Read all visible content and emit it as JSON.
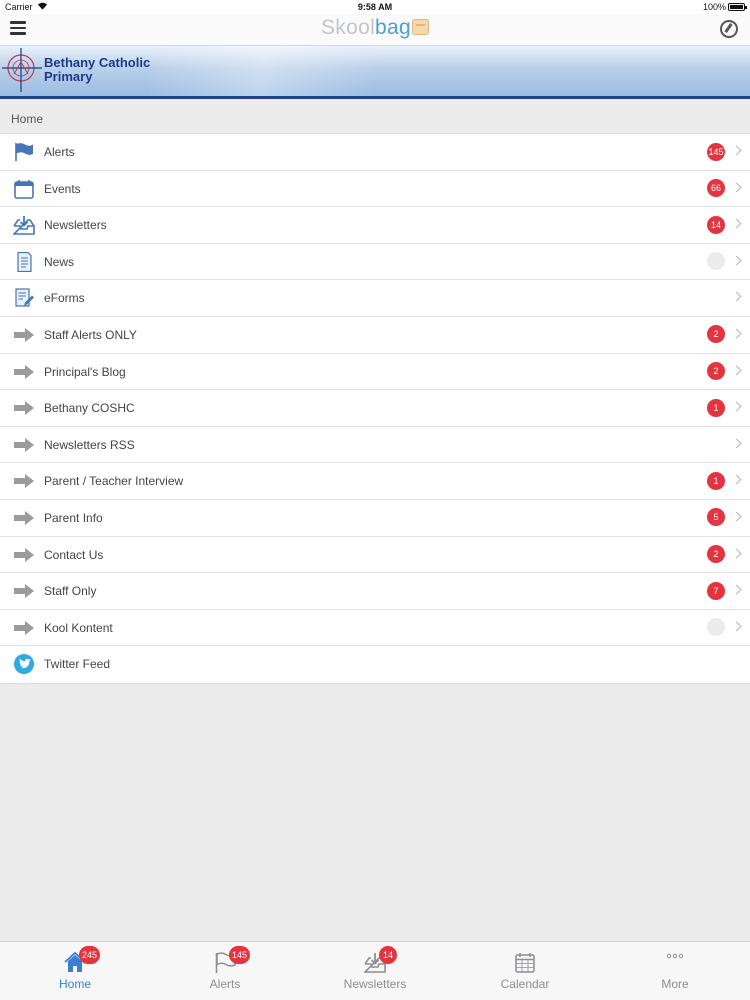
{
  "status_bar": {
    "carrier": "Carrier",
    "time": "9:58 AM",
    "battery": "100%"
  },
  "nav": {
    "brand_part1": "Skool",
    "brand_part2": "bag"
  },
  "school": {
    "name_line1": "Bethany Catholic",
    "name_line2": "Primary"
  },
  "breadcrumb": "Home",
  "list": [
    {
      "label": "Alerts",
      "icon": "flag-icon",
      "badge": "145"
    },
    {
      "label": "Events",
      "icon": "calendar-icon",
      "badge": "66"
    },
    {
      "label": "Newsletters",
      "icon": "inbox-download-icon",
      "badge": "14"
    },
    {
      "label": "News",
      "icon": "document-icon",
      "badge": ""
    },
    {
      "label": "eForms",
      "icon": "form-edit-icon",
      "badge": null
    },
    {
      "label": "Staff Alerts ONLY",
      "icon": "arrow-right-icon",
      "badge": "2"
    },
    {
      "label": "Principal's Blog",
      "icon": "arrow-right-icon",
      "badge": "2"
    },
    {
      "label": "Bethany COSHC",
      "icon": "arrow-right-icon",
      "badge": "1"
    },
    {
      "label": "Newsletters RSS",
      "icon": "arrow-right-icon",
      "badge": null
    },
    {
      "label": "Parent / Teacher Interview",
      "icon": "arrow-right-icon",
      "badge": "1"
    },
    {
      "label": "Parent Info",
      "icon": "arrow-right-icon",
      "badge": "5"
    },
    {
      "label": "Contact Us",
      "icon": "arrow-right-icon",
      "badge": "2"
    },
    {
      "label": "Staff Only",
      "icon": "arrow-right-icon",
      "badge": "7"
    },
    {
      "label": "Kool Kontent",
      "icon": "arrow-right-icon",
      "badge": ""
    },
    {
      "label": "Twitter Feed",
      "icon": "twitter-icon",
      "badge": null
    }
  ],
  "tabs": [
    {
      "label": "Home",
      "icon": "home-icon",
      "badge": "245",
      "active": true
    },
    {
      "label": "Alerts",
      "icon": "flag-icon",
      "badge": "145",
      "active": false
    },
    {
      "label": "Newsletters",
      "icon": "inbox-download-icon",
      "badge": "14",
      "active": false
    },
    {
      "label": "Calendar",
      "icon": "calendar-icon",
      "badge": null,
      "active": false
    },
    {
      "label": "More",
      "icon": "more-dots-icon",
      "badge": null,
      "active": false
    }
  ],
  "colors": {
    "accent": "#3a7fd6",
    "badge": "#e3343f",
    "banner_dark": "#23408e",
    "brand_blue": "#4a9fd6"
  }
}
